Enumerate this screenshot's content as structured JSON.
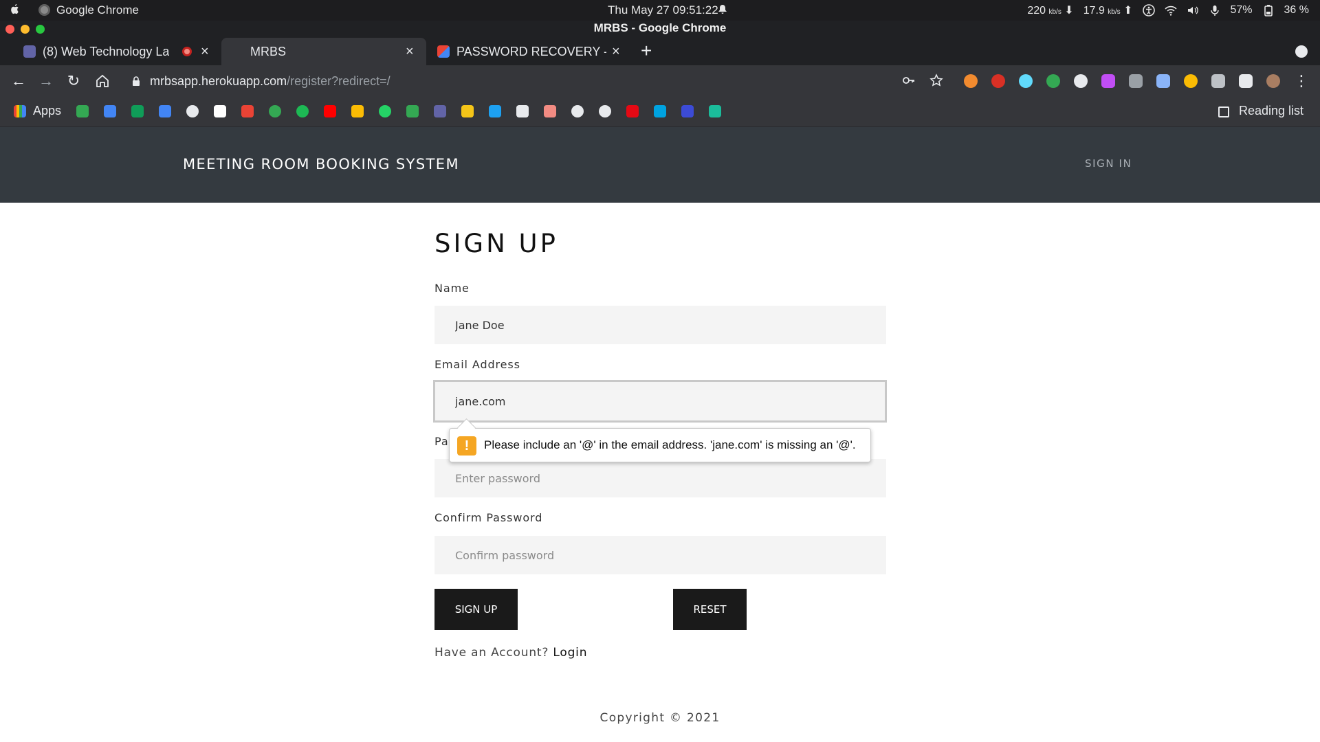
{
  "os": {
    "app_name": "Google Chrome",
    "clock": "Thu May 27  09:51:22",
    "net_down": "220",
    "net_down_unit": "kb/s",
    "net_up": "17.9",
    "net_up_unit": "kb/s",
    "volume": "57%",
    "battery": "36 %"
  },
  "window": {
    "title": "MRBS - Google Chrome"
  },
  "tabs": [
    {
      "title": "(8) Web Technology La",
      "active": false
    },
    {
      "title": "MRBS",
      "active": true
    },
    {
      "title": "PASSWORD RECOVERY - s",
      "active": false
    }
  ],
  "omnibox": {
    "host": "mrbsapp.herokuapp.com",
    "path": "/register?redirect=/"
  },
  "bookmarks": {
    "apps_label": "Apps",
    "reading_list": "Reading list"
  },
  "site": {
    "brand": "MEETING ROOM BOOKING SYSTEM",
    "nav_signin": "SIGN IN"
  },
  "form": {
    "heading": "SIGN UP",
    "name_label": "Name",
    "name_value": "Jane Doe",
    "email_label": "Email Address",
    "email_value": "jane.com",
    "password_label": "Password",
    "password_placeholder": "Enter password",
    "confirm_label": "Confirm Password",
    "confirm_placeholder": "Confirm password",
    "signup_button": "SIGN UP",
    "reset_button": "RESET",
    "account_prompt": "Have an Account?",
    "login_link": "Login"
  },
  "validation": {
    "icon": "!",
    "message": "Please include an '@' in the email address. 'jane.com' is missing an '@'."
  },
  "footer": {
    "copyright": "Copyright © 2021"
  },
  "colors": {
    "header_bg": "#343a40",
    "button_bg": "#1a1a1a",
    "warning": "#f5a623"
  }
}
